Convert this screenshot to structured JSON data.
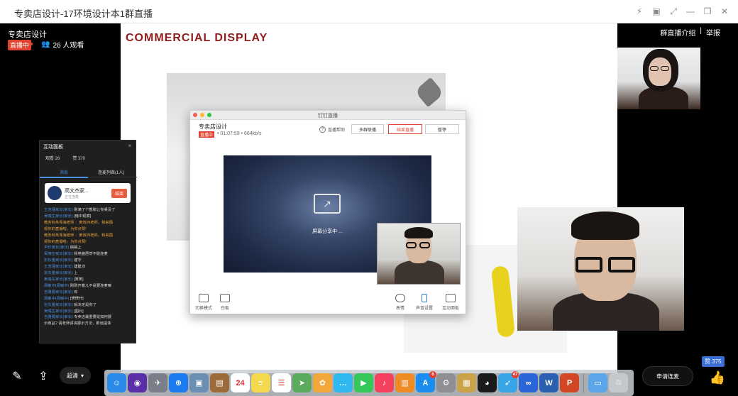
{
  "window": {
    "title": "专卖店设计-17环境设计本1群直播"
  },
  "live": {
    "name": "专卖店设计",
    "badge": "直播中",
    "viewers": "26 人观看",
    "links": [
      "群直播介绍",
      "|",
      "举报"
    ]
  },
  "slide": {
    "title": "COMMERCIAL  DISPLAY"
  },
  "dingtalk": {
    "window_title": "钉钉直播",
    "name": "专卖店设计",
    "badge": "直播中",
    "stats": "• 01:07:59  •  664kb/s",
    "help": "直播帮助",
    "buttons": [
      "多群联播",
      "结束直播",
      "暂停"
    ],
    "share_text": "屏幕分享中 ...",
    "tools_left": [
      "切换模式",
      "白板"
    ],
    "tools_right": [
      "表情",
      "声音设置",
      "互动面板"
    ]
  },
  "panel": {
    "title": "互动面板",
    "close": "×",
    "stats": [
      "观看 26",
      "赞 370"
    ],
    "tabs": [
      "消息",
      "连麦列表(1人)"
    ],
    "card": {
      "name": "高文杰家...",
      "sub": "正在连麦",
      "button": "结束"
    },
    "messages": [
      {
        "user": "王浩瑾家长(家长)",
        "text": "刚满了个暂歇让你桌没了",
        "style": "normal"
      },
      {
        "user": "吴瑞生家长(家长)",
        "text": "[暗中观察]",
        "style": "normal"
      },
      {
        "user": "教务科朱青海老师",
        "text": "：黄效炜老师，我来围",
        "style": "orange"
      },
      {
        "user": "",
        "text": "观你的直播啦，为你点赞!",
        "style": "orange"
      },
      {
        "user": "教务科朱青海老师",
        "text": "：黄效炜老师，我来围",
        "style": "orange"
      },
      {
        "user": "",
        "text": "观你的直播啦，为你点赞!",
        "style": "orange"
      },
      {
        "user": "尹乐家长(家长)",
        "text": "稿稿上",
        "style": "normal"
      },
      {
        "user": "吴瑞生家长(家长)",
        "text": "我电脑居然不能连麦",
        "style": "normal"
      },
      {
        "user": "张东量家长(家长)",
        "text": "建宇",
        "style": "normal"
      },
      {
        "user": "王浩瑾家长(家长)",
        "text": "建建沛",
        "style": "normal"
      },
      {
        "user": "张东量家长(家长)",
        "text": "上",
        "style": "normal"
      },
      {
        "user": "黄瑞东家长(家长)",
        "text": "[笑笑]",
        "style": "normal"
      },
      {
        "user": "周敏中(周敏中)",
        "text": "刚刚开着儿不是要连麦嘛",
        "style": "normal"
      },
      {
        "user": "吉雅蕾家长(家长)",
        "text": "有",
        "style": "normal"
      },
      {
        "user": "周敏中(周敏中)",
        "text": "[愣愣开]",
        "style": "normal"
      },
      {
        "user": "张东量家长(家长)",
        "text": "就决定是你了",
        "style": "normal"
      },
      {
        "user": "吴瑞生家长(家长)",
        "text": "[图片]",
        "style": "normal"
      },
      {
        "user": "吉雅蕾家长(家长)",
        "text": "专卖店最重要是如何展",
        "style": "normal"
      },
      {
        "user": "",
        "text": "示商品? 请老师讲讲展示方法，那谈提体",
        "style": "normal"
      }
    ]
  },
  "bottom": {
    "clarity": "超清",
    "connect": "申请连麦",
    "likes": "赞 375"
  },
  "dock": {
    "icons": [
      {
        "name": "finder",
        "color": "#2a8ae8",
        "glyph": "☺"
      },
      {
        "name": "siri",
        "color": "#5a2ea6",
        "glyph": "◉"
      },
      {
        "name": "launchpad",
        "color": "#7a7f8a",
        "glyph": "✈"
      },
      {
        "name": "safari",
        "color": "#1a7cf0",
        "glyph": "⊕"
      },
      {
        "name": "preview",
        "color": "#6b8fb3",
        "glyph": "▣"
      },
      {
        "name": "notebook",
        "color": "#9c6b3b",
        "glyph": "▤"
      },
      {
        "name": "calendar",
        "color": "#ffffff",
        "glyph": "24"
      },
      {
        "name": "notes",
        "color": "#f4d84e",
        "glyph": "≡"
      },
      {
        "name": "reminders",
        "color": "#ffffff",
        "glyph": "☰"
      },
      {
        "name": "maps",
        "color": "#5caa5b",
        "glyph": "➤"
      },
      {
        "name": "photos",
        "color": "#f2a73b",
        "glyph": "✿"
      },
      {
        "name": "messages",
        "color": "#2fb7f0",
        "glyph": "…"
      },
      {
        "name": "facetime",
        "color": "#35c759",
        "glyph": "▶"
      },
      {
        "name": "music",
        "color": "#f5405e",
        "glyph": "♪"
      },
      {
        "name": "books",
        "color": "#f08a24",
        "glyph": "▥"
      },
      {
        "name": "appstore",
        "color": "#1d8cf0",
        "glyph": "A",
        "badge": "6"
      },
      {
        "name": "settings",
        "color": "#8e8e93",
        "glyph": "⚙"
      },
      {
        "name": "archive",
        "color": "#c9a24a",
        "glyph": "▦"
      },
      {
        "name": "qq",
        "color": "#1b1b1b",
        "glyph": "◕"
      },
      {
        "name": "mail-plane",
        "color": "#37a5e6",
        "glyph": "➶",
        "badge": "47"
      },
      {
        "name": "baidu-cloud",
        "color": "#2a66d8",
        "glyph": "∞"
      },
      {
        "name": "word",
        "color": "#2b5fb0",
        "glyph": "W"
      },
      {
        "name": "powerpoint",
        "color": "#d24726",
        "glyph": "P"
      },
      {
        "name": "folder",
        "color": "#5aa6e8",
        "glyph": "▭"
      },
      {
        "name": "trash",
        "color": "#c5c8cc",
        "glyph": "♲"
      }
    ]
  }
}
